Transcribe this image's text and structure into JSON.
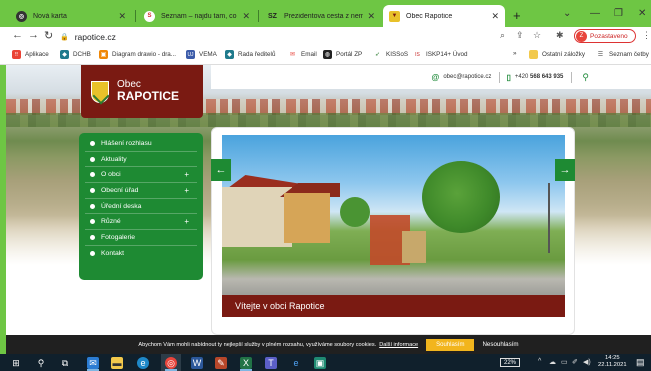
{
  "browser": {
    "tabs": [
      {
        "title": "Nová karta",
        "icon": "chrome-icon",
        "active": false
      },
      {
        "title": "Seznam – najdu tam, co nezná",
        "icon": "seznam-icon",
        "active": false
      },
      {
        "title": "Prezidentova cesta z nemocnic",
        "icon": "sz",
        "active": false
      },
      {
        "title": "Obec Rapotice",
        "icon": "crest-icon",
        "active": true
      }
    ],
    "new_tab": "+",
    "address": "rapotice.cz",
    "profile": {
      "initial": "Z",
      "label": "Pozastaveno"
    }
  },
  "bookmarks": {
    "items": [
      {
        "label": "Aplikace",
        "color": "#ea4335"
      },
      {
        "label": "DCHB",
        "color": "#1f7a8c"
      },
      {
        "label": "Diagram drawio - dra...",
        "color": "#f08705"
      },
      {
        "label": "VEMA",
        "color": "#3b5ba9"
      },
      {
        "label": "Rada ředitelů",
        "color": "#1f7a8c"
      },
      {
        "label": "Email",
        "color": "#e8453c"
      },
      {
        "label": "Portál ZP",
        "color": "#222222"
      },
      {
        "label": "KISSoS",
        "color": "#2e7d32"
      },
      {
        "label": "ISKP14+ Úvod",
        "color": "#c62828"
      }
    ],
    "more": "»",
    "other": "Ostatní záložky",
    "reading": "Seznam četby"
  },
  "site": {
    "logo": {
      "line1": "Obec",
      "line2": "RAPOTICE"
    },
    "contact": {
      "email": "obec@rapotice.cz",
      "phone_prefix": "+420",
      "phone_number": "568 643 935"
    },
    "menu": [
      {
        "label": "Hlášení rozhlasu",
        "has_submenu": false
      },
      {
        "label": "Aktuality",
        "has_submenu": false
      },
      {
        "label": "O obci",
        "has_submenu": true
      },
      {
        "label": "Obecní úřad",
        "has_submenu": true
      },
      {
        "label": "Úřední deska",
        "has_submenu": false
      },
      {
        "label": "Různé",
        "has_submenu": true
      },
      {
        "label": "Fotogalerie",
        "has_submenu": false
      },
      {
        "label": "Kontakt",
        "has_submenu": false
      }
    ],
    "submenu_symbol": "+",
    "slider": {
      "caption": "Vítejte v obci Rapotice",
      "prev": "←",
      "next": "→"
    },
    "colors": {
      "brand_green": "#1e8a33",
      "brand_maroon": "#7a1a12",
      "cookie_button": "#f2b51d"
    }
  },
  "cookie": {
    "text": "Abychom Vám mohli nabídnout ty nejlepší služby v plném rozsahu, využíváme soubory cookies.",
    "link": "Další informace",
    "accept": "Souhlasím",
    "decline": "Nesouhlasím"
  },
  "taskbar": {
    "battery": "22%",
    "time": "14:25",
    "date": "22.11.2021"
  }
}
